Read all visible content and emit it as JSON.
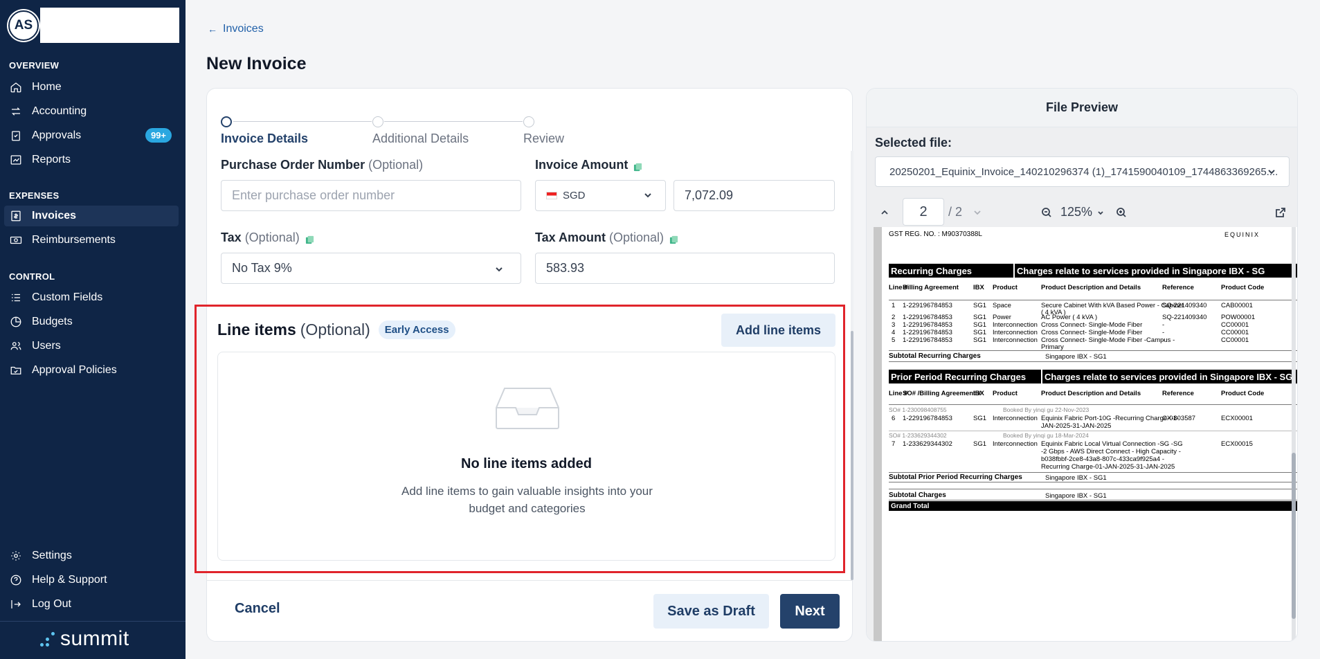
{
  "sidebar": {
    "avatar_initials": "AS",
    "sections": {
      "overview": "OVERVIEW",
      "expenses": "EXPENSES",
      "control": "CONTROL"
    },
    "items": {
      "home": "Home",
      "accounting": "Accounting",
      "approvals": "Approvals",
      "approvals_badge": "99+",
      "reports": "Reports",
      "invoices": "Invoices",
      "reimbursements": "Reimbursements",
      "custom_fields": "Custom Fields",
      "budgets": "Budgets",
      "users": "Users",
      "approval_policies": "Approval Policies",
      "settings": "Settings",
      "help": "Help & Support",
      "logout": "Log Out"
    },
    "brand": "summit"
  },
  "header": {
    "back_label": "Invoices",
    "title": "New Invoice"
  },
  "stepper": {
    "steps": [
      "Invoice Details",
      "Additional Details",
      "Review"
    ],
    "current": 0
  },
  "form": {
    "po_label": "Purchase Order Number",
    "po_optional": "(Optional)",
    "po_placeholder": "Enter purchase order number",
    "amount_label": "Invoice Amount",
    "currency": "SGD",
    "amount_value": "7,072.09",
    "tax_label": "Tax",
    "tax_optional": "(Optional)",
    "tax_value": "No Tax 9%",
    "tax_amount_label": "Tax Amount",
    "tax_amount_optional": "(Optional)",
    "tax_amount_value": "583.93"
  },
  "line_items": {
    "title": "Line items",
    "optional": "(Optional)",
    "badge": "Early Access",
    "add_button": "Add line items",
    "empty_title": "No line items added",
    "empty_subtitle": "Add line items to gain valuable insights into your budget and categories"
  },
  "footer": {
    "cancel": "Cancel",
    "save_draft": "Save as Draft",
    "next": "Next"
  },
  "preview": {
    "title": "File Preview",
    "selected_label": "Selected file:",
    "selected_file": "20250201_Equinix_Invoice_140210296374 (1)_1741590040109_1744863369265....",
    "page": "2",
    "page_total": "/ 2",
    "zoom": "125%",
    "doc": {
      "gst": "GST REG. NO. : M90370388L",
      "logo": "EQUINIX",
      "recurring_title": "Recurring Charges",
      "relate_title": "Charges relate to services provided in Singapore IBX - SG",
      "headers": [
        "Line #",
        "Billing Agreement",
        "IBX",
        "Product",
        "Product Description and Details",
        "Reference",
        "Product Code"
      ],
      "rows": [
        {
          "line": "1",
          "agreement": "1-229196784853",
          "ibx": "SG1",
          "product": "Space",
          "desc": "Secure Cabinet With kVA Based Power - Cabinet",
          "desc2": "( 4 kVA )",
          "ref": "SQ-221409340",
          "code": "CAB00001"
        },
        {
          "line": "2",
          "agreement": "1-229196784853",
          "ibx": "SG1",
          "product": "Power",
          "desc": "AC Power ( 4 kVA )",
          "ref": "SQ-221409340",
          "code": "POW00001"
        },
        {
          "line": "3",
          "agreement": "1-229196784853",
          "ibx": "SG1",
          "product": "Interconnection",
          "desc": "Cross Connect- Single-Mode Fiber",
          "ref": "-",
          "code": "CC00001"
        },
        {
          "line": "4",
          "agreement": "1-229196784853",
          "ibx": "SG1",
          "product": "Interconnection",
          "desc": "Cross Connect- Single-Mode Fiber",
          "ref": "-",
          "code": "CC00001"
        },
        {
          "line": "5",
          "agreement": "1-229196784853",
          "ibx": "SG1",
          "product": "Interconnection",
          "desc": "Cross Connect- Single-Mode Fiber -Campus -",
          "desc2": "Primary",
          "ref": "-",
          "code": "CC00001"
        }
      ],
      "subtotal_recurring": "Subtotal Recurring Charges",
      "subtotal_recurring_loc": "Singapore IBX - SG1",
      "prior_title": "Prior Period Recurring Charges",
      "prior_headers": [
        "Line #",
        "SO# /Billing Agreement #",
        "IBX",
        "Product",
        "Product Description and Details",
        "Reference",
        "Product Code"
      ],
      "so1": "SO# 1-230098408755",
      "booked1": "Booked By yinqi gu 22-Nov-2023",
      "row6": {
        "line": "6",
        "agreement": "1-229196784853",
        "ibx": "SG1",
        "product": "Interconnection",
        "desc": "Equinix Fabric Port-10G -Recurring Charge-01-",
        "desc2": "JAN-2025-31-JAN-2025",
        "ref": "CX-803587",
        "code": "ECX00001"
      },
      "so2": "SO# 1-233629344302",
      "booked2": "Booked By yinqi gu 18-Mar-2024",
      "row7": {
        "line": "7",
        "agreement": "1-233629344302",
        "ibx": "SG1",
        "product": "Interconnection",
        "desc": "Equinix Fabric Local Virtual Connection -SG -SG",
        "desc2": "-2 Gbps - AWS Direct Connect - High Capacity -",
        "desc3": "b038fbbf-2ce8-43a8-807c-433ca9f925a4 -",
        "desc4": "Recurring Charge-01-JAN-2025-31-JAN-2025",
        "ref": "-",
        "code": "ECX00015"
      },
      "subtotal_prior": "Subtotal Prior Period Recurring Charges",
      "subtotal_prior_loc": "Singapore IBX - SG1",
      "subtotal_charges": "Subtotal Charges",
      "subtotal_charges_loc": "Singapore IBX - SG1",
      "grand_total": "Grand Total"
    }
  },
  "colors": {
    "sidebar_bg": "#0f2546",
    "primary": "#24426b",
    "accent_badge": "#2aa7e0",
    "highlight_border": "#e0242b"
  }
}
